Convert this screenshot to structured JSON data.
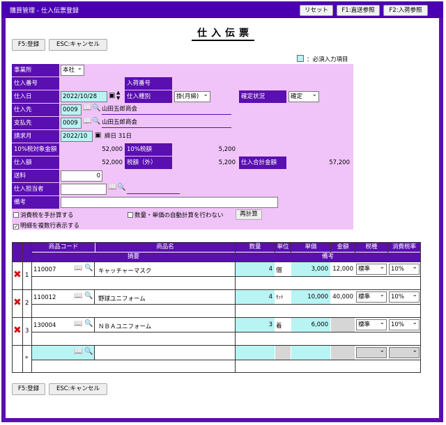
{
  "header": {
    "app_title": "購買管理 - 仕入伝票登録",
    "reset_label": "リセット",
    "f1_label": "F1:直送参照",
    "f2_label": "F2:入荷参照"
  },
  "page_title": "仕入伝票",
  "actions": {
    "register_label": "F5:登録",
    "cancel_label": "ESC:キャンセル"
  },
  "legend": {
    "required_label": "：必須入力項目"
  },
  "form": {
    "office_label": "事業所",
    "office_value": "本社",
    "purchase_no_label": "仕入番号",
    "receipt_no_label": "入荷番号",
    "purchase_date_label": "仕入日",
    "purchase_date_value": "2022/10/28",
    "purchase_type_label": "仕入種別",
    "purchase_type_value": "掛(月締)",
    "confirm_status_label": "確定状況",
    "confirm_status_value": "確定",
    "supplier_label": "仕入先",
    "supplier_code": "0009",
    "supplier_name": "山田五郎商会",
    "payee_label": "支払先",
    "payee_code": "0009",
    "payee_name": "山田五郎商会",
    "billing_month_label": "請求月",
    "billing_month_value": "2022/10",
    "closing_day": "締日 31日",
    "taxable10_label": "10%税対象金額",
    "taxable10_value": "52,000",
    "tax10_label": "10%税額",
    "tax10_value": "5,200",
    "purchase_amount_label": "仕入額",
    "purchase_amount_value": "52,000",
    "tax_excl_label": "税額（外）",
    "tax_excl_value": "5,200",
    "total_label": "仕入合計金額",
    "total_value": "57,200",
    "shipping_label": "送料",
    "shipping_value": "0",
    "person_label": "仕入担当者",
    "memo_label": "備考",
    "manual_tax_label": "消費税を手計算する",
    "no_autocalc_label": "数量・単価の自動計算を行わない",
    "recalc_label": "再計算",
    "multiline_label": "明細を複数行表示する"
  },
  "grid": {
    "headers": {
      "code": "商品コード",
      "name": "商品名",
      "summary": "摘要",
      "qty": "数量",
      "unit": "単位",
      "price": "単価",
      "amount": "金額",
      "tax_rule": "税種",
      "tax_rate": "消費税率",
      "note": "備考"
    },
    "rows": [
      {
        "no": "1",
        "code": "110007",
        "name": "キャッチャーマスク",
        "qty": "4",
        "unit": "個",
        "price": "3,000",
        "amount": "12,000",
        "tax_rule": "標準",
        "tax_rate": "10%"
      },
      {
        "no": "2",
        "code": "110012",
        "name": "野球ユニフォーム",
        "qty": "4",
        "unit": "ｾｯﾄ",
        "price": "10,000",
        "amount": "40,000",
        "tax_rule": "標準",
        "tax_rate": "10%"
      },
      {
        "no": "3",
        "code": "130004",
        "name": "ＮＢＡユニフォーム",
        "qty": "3",
        "unit": "着",
        "price": "6,000",
        "amount": "",
        "tax_rule": "標準",
        "tax_rate": "10%"
      }
    ],
    "new_row_marker": "*"
  },
  "colors": {
    "accent": "#5a0fb0",
    "form_bg": "#f0c4f8",
    "required": "#b8f4f4",
    "delete": "#d01010"
  }
}
